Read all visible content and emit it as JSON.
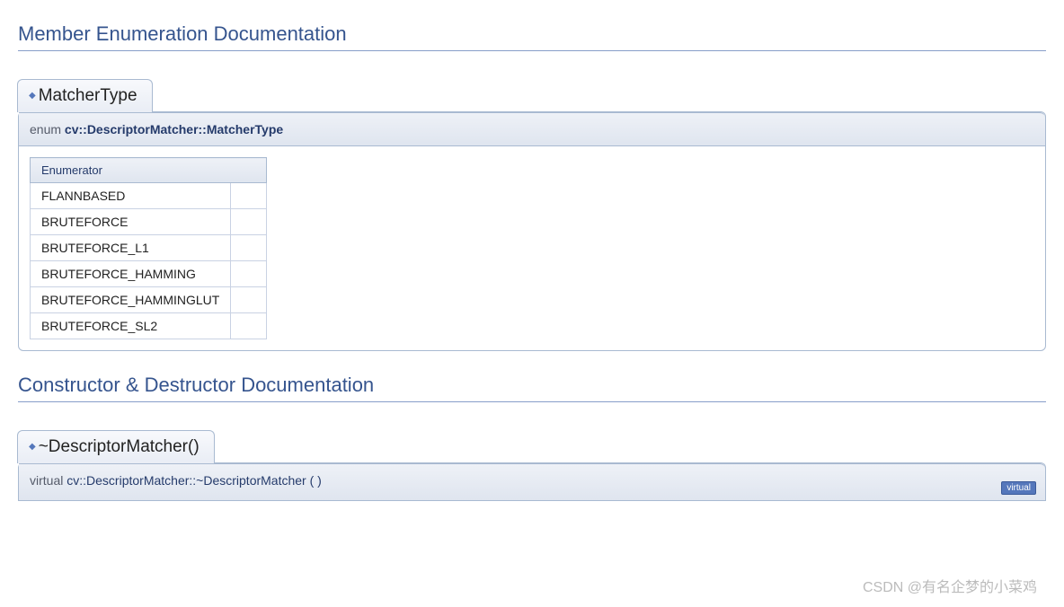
{
  "section1": {
    "title": "Member Enumeration Documentation",
    "memberTitle": "MatcherType",
    "proto": {
      "kw": "enum",
      "scoped": "cv::DescriptorMatcher::MatcherType"
    },
    "enumTable": {
      "header": "Enumerator",
      "rows": [
        "FLANNBASED",
        "BRUTEFORCE",
        "BRUTEFORCE_L1",
        "BRUTEFORCE_HAMMING",
        "BRUTEFORCE_HAMMINGLUT",
        "BRUTEFORCE_SL2"
      ]
    }
  },
  "section2": {
    "title": "Constructor & Destructor Documentation",
    "memberTitle": "~DescriptorMatcher()",
    "proto": {
      "kw": "virtual",
      "scoped": "cv::DescriptorMatcher::~DescriptorMatcher",
      "paren": "(   )",
      "badge": "virtual"
    }
  },
  "glyphs": {
    "anchor": "◆"
  },
  "watermark": "CSDN @有名企梦的小菜鸡"
}
